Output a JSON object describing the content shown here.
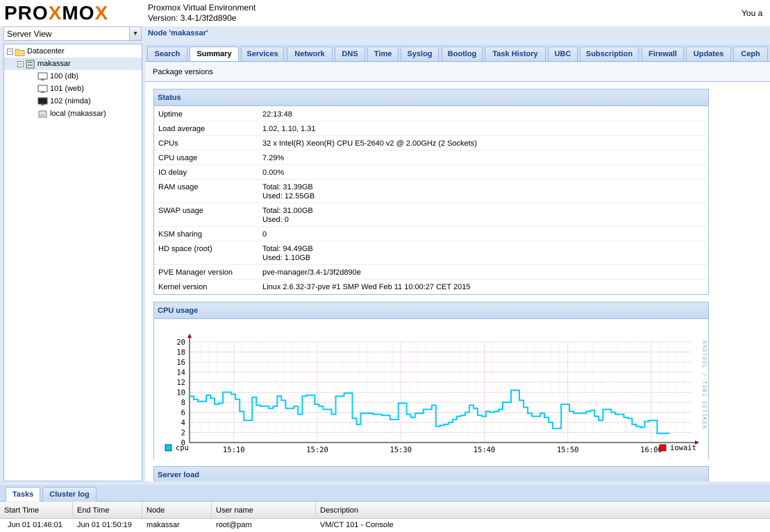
{
  "header": {
    "logo_text": "PROXMOX",
    "product": "Proxmox Virtual Environment",
    "version": "Version: 3.4-1/3f2d890e",
    "login_text": "You a"
  },
  "server_view": {
    "value": "Server View"
  },
  "node_title": "Node 'makassar'",
  "tree": [
    {
      "label": "Datacenter",
      "icon": "datacenter-folder-icon"
    },
    {
      "label": "makassar",
      "icon": "node-server-icon"
    },
    {
      "label": "100 (db)",
      "icon": "vm-monitor-icon"
    },
    {
      "label": "101 (web)",
      "icon": "vm-monitor-icon"
    },
    {
      "label": "102 (nimda)",
      "icon": "vm-monitor-running-icon"
    },
    {
      "label": "local (makassar)",
      "icon": "storage-disk-icon"
    }
  ],
  "tabs": [
    "Search",
    "Summary",
    "Services",
    "Network",
    "DNS",
    "Time",
    "Syslog",
    "Bootlog",
    "Task History",
    "UBC",
    "Subscription",
    "Firewall",
    "Updates",
    "Ceph"
  ],
  "active_tab": "Summary",
  "toolbar": {
    "package_versions": "Package versions"
  },
  "status": {
    "title": "Status",
    "rows": [
      {
        "key": "Uptime",
        "value": "22:13:48"
      },
      {
        "key": "Load average",
        "value": "1.02, 1.10, 1.31"
      },
      {
        "key": "CPUs",
        "value": "32 x Intel(R) Xeon(R) CPU E5-2640 v2 @ 2.00GHz (2 Sockets)"
      },
      {
        "key": "CPU usage",
        "value": "7.29%"
      },
      {
        "key": "IO delay",
        "value": "0.00%"
      },
      {
        "key": "RAM usage",
        "value": "Total: 31.39GB",
        "value2": "Used: 12.55GB"
      },
      {
        "key": "SWAP usage",
        "value": "Total: 31.00GB",
        "value2": "Used: 0"
      },
      {
        "key": "KSM sharing",
        "value": "0"
      },
      {
        "key": "HD space (root)",
        "value": "Total: 94.49GB",
        "value2": "Used: 1.10GB"
      },
      {
        "key": "PVE Manager version",
        "value": "pve-manager/3.4-1/3f2d890e"
      },
      {
        "key": "Kernel version",
        "value": "Linux 2.6.32-37-pve #1 SMP Wed Feb 11 10:00:27 CET 2015"
      }
    ]
  },
  "cpu_panel": {
    "title": "CPU usage",
    "watermark": "RRDTOOL / TOBI OETIKER"
  },
  "server_load_panel": {
    "title": "Server load"
  },
  "chart_data": {
    "type": "line",
    "title": "",
    "xlabel": "",
    "ylabel": "",
    "ylim": [
      0,
      20
    ],
    "yticks": [
      0,
      2,
      4,
      6,
      8,
      10,
      12,
      14,
      16,
      18,
      20
    ],
    "xticks": [
      "15:10",
      "15:20",
      "15:30",
      "15:40",
      "15:50",
      "16:00"
    ],
    "xtick_minutes": [
      10,
      20,
      30,
      40,
      50,
      60
    ],
    "xlim_minutes": [
      4.7,
      64.9
    ],
    "grid": true,
    "legend": [
      {
        "name": "cpu",
        "color": "#00ccff"
      },
      {
        "name": "iowait",
        "color": "#ff0000"
      }
    ],
    "series": [
      {
        "name": "cpu",
        "color": "#00ccff",
        "step": true,
        "x_minutes": [
          4.7,
          5.2,
          5.7,
          6.2,
          6.7,
          7.2,
          7.7,
          8.2,
          8.7,
          9.2,
          9.7,
          10.2,
          10.7,
          11.2,
          11.7,
          12.2,
          12.7,
          13.2,
          13.7,
          14.2,
          14.7,
          15.2,
          15.7,
          16.2,
          16.7,
          17.2,
          17.7,
          18.2,
          18.7,
          19.2,
          19.7,
          20.2,
          20.7,
          21.2,
          21.7,
          22.2,
          22.7,
          23.2,
          23.7,
          24.2,
          24.7,
          25.2,
          25.7,
          26.2,
          26.7,
          27.2,
          27.7,
          28.2,
          28.7,
          29.2,
          29.7,
          30.2,
          30.7,
          31.2,
          31.7,
          32.2,
          32.7,
          33.2,
          33.7,
          34.2,
          34.7,
          35.2,
          35.7,
          36.2,
          36.7,
          37.2,
          37.7,
          38.2,
          38.7,
          39.2,
          39.7,
          40.2,
          40.7,
          41.2,
          41.7,
          42.2,
          42.7,
          43.2,
          43.7,
          44.2,
          44.7,
          45.2,
          45.7,
          46.2,
          46.7,
          47.2,
          47.7,
          48.2,
          48.7,
          49.2,
          49.7,
          50.2,
          50.7,
          51.2,
          51.7,
          52.2,
          52.7,
          53.2,
          53.7,
          54.2,
          54.7,
          55.2,
          55.7,
          56.2,
          56.7,
          57.2,
          57.7,
          58.2,
          58.7,
          59.2,
          59.7,
          60.2,
          60.7,
          61.2,
          61.7,
          62.2,
          62.7,
          63.2
        ],
        "values": [
          9.2,
          8.6,
          8.2,
          8.2,
          9.4,
          8.8,
          7.6,
          7.8,
          10.0,
          10.0,
          9.6,
          8.6,
          6.2,
          4.4,
          4.4,
          9.0,
          7.4,
          7.2,
          7.2,
          6.8,
          7.2,
          9.2,
          8.4,
          6.8,
          6.8,
          7.2,
          5.6,
          9.2,
          9.4,
          9.4,
          7.6,
          7.2,
          6.6,
          6.6,
          5.6,
          9.2,
          9.2,
          9.8,
          9.8,
          4.8,
          3.6,
          5.8,
          5.8,
          5.8,
          5.6,
          5.6,
          5.4,
          5.4,
          4.6,
          4.6,
          7.8,
          7.8,
          5.6,
          5.0,
          5.8,
          5.8,
          6.6,
          6.6,
          7.4,
          3.2,
          3.4,
          3.6,
          4.0,
          4.6,
          5.2,
          5.4,
          6.0,
          7.4,
          6.8,
          5.4,
          5.2,
          6.2,
          6.0,
          6.2,
          6.6,
          8.0,
          8.0,
          10.4,
          10.4,
          8.4,
          7.0,
          5.8,
          5.2,
          5.2,
          5.8,
          5.0,
          4.0,
          2.8,
          2.8,
          7.6,
          7.6,
          6.2,
          5.8,
          5.8,
          5.8,
          6.2,
          6.4,
          5.2,
          4.4,
          6.6,
          6.6,
          6.0,
          5.6,
          5.6,
          5.0,
          4.8,
          3.6,
          3.2,
          3.0,
          4.2,
          4.4,
          4.4,
          1.8,
          1.8,
          1.8
        ]
      },
      {
        "name": "iowait",
        "color": "#ff0000",
        "values": []
      }
    ]
  },
  "bottom": {
    "tabs": [
      "Tasks",
      "Cluster log"
    ],
    "columns": [
      "Start Time",
      "End Time",
      "Node",
      "User name",
      "Description"
    ],
    "rows": [
      [
        "Jun 01 01:46:01",
        "Jun 01 01:50:19",
        "makassar",
        "root@pam",
        "VM/CT 101 - Console"
      ]
    ]
  }
}
